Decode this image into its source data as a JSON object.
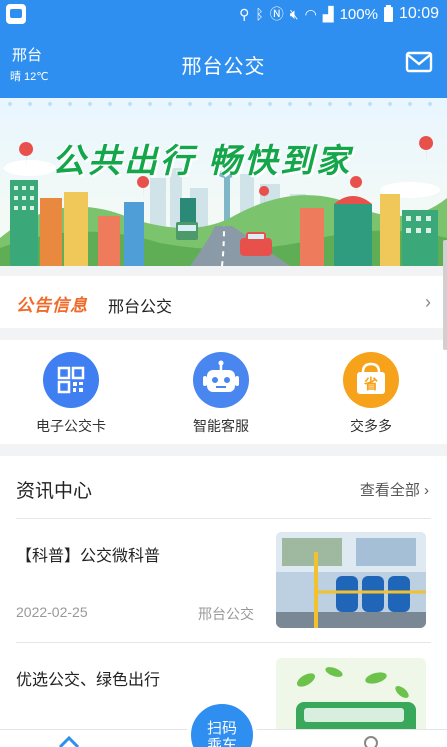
{
  "status_bar": {
    "battery": "100%",
    "time": "10:09"
  },
  "header": {
    "city": "邢台",
    "weather": "晴 12℃",
    "title": "邢台公交",
    "mail_icon": "mail-icon"
  },
  "banner": {
    "slogan": "公共出行 畅快到家"
  },
  "notice": {
    "tag": "公告信息",
    "text": "邢台公交",
    "chevron": "›"
  },
  "quick_actions": [
    {
      "label": "电子公交卡",
      "icon": "qr-card-icon",
      "color": "#3f7ff2"
    },
    {
      "label": "智能客服",
      "icon": "robot-icon",
      "color": "#4a86f0"
    },
    {
      "label": "交多多",
      "icon": "shopping-bag-icon",
      "color": "#f7a21b"
    }
  ],
  "news": {
    "title": "资讯中心",
    "view_all": "查看全部 ›",
    "items": [
      {
        "title": "【科普】公交微科普",
        "date": "2022-02-25",
        "source": "邢台公交"
      },
      {
        "title": "优选公交、绿色出行"
      }
    ]
  },
  "scan_button": {
    "line1": "扫码",
    "line2": "乘车"
  },
  "colors": {
    "primary": "#2e8ff0",
    "notice_tag": "#f06a2a",
    "slogan": "#13a64a"
  }
}
